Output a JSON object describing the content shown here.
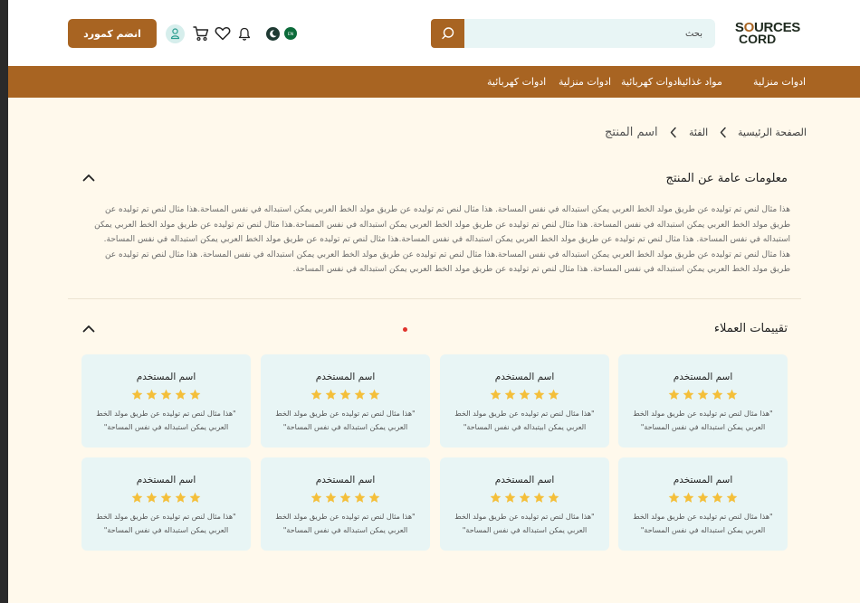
{
  "header": {
    "logo_line1_a": "S",
    "logo_line1_o": "O",
    "logo_line1_b": "URCES",
    "logo_line2": "CORD",
    "search_placeholder": "بحث",
    "join_label": "انضم كمورد",
    "lang_flag_text": "EN"
  },
  "nav": {
    "items": [
      "ادوات منزلية",
      "مواد غذائية",
      "ادوات كهربائية",
      "ادوات منزلية",
      "ادوات كهربائية"
    ]
  },
  "breadcrumb": {
    "home": "الصفحة الرئيسية",
    "category": "الفئة",
    "current": "اسم المنتج"
  },
  "info_section": {
    "title": "معلومات عامة عن المنتج",
    "description": "هذا مثال لنص تم توليده عن طريق مولد الخط العربي يمكن استبداله في نفس المساحة. هذا مثال لنص تم توليده عن طريق مولد الخط العربي يمكن استبداله في نفس المساحة.هذا مثال لنص تم توليده عن طريق مولد الخط العربي يمكن استبداله في نفس المساحة. هذا مثال لنص تم توليده عن طريق مولد الخط العربي يمكن استبداله في نفس المساحة.هذا مثال لنص تم توليده عن طريق مولد الخط العربي يمكن استبداله في نفس المساحة. هذا مثال لنص تم توليده عن طريق مولد الخط العربي يمكن استبداله في نفس المساحة.هذا مثال لنص تم توليده عن طريق مولد الخط العربي يمكن استبداله في نفس المساحة. هذا مثال لنص تم توليده عن طريق مولد الخط العربي يمكن استبداله في نفس المساحة.هذا مثال لنص تم توليده عن طريق مولد الخط العربي يمكن استبداله في نفس المساحة. هذا مثال لنص تم توليده عن طريق مولد الخط العربي يمكن استبداله في نفس المساحة. هذا مثال لنص تم توليده عن طريق مولد الخط العربي يمكن استبداله في نفس المساحة."
  },
  "reviews_section": {
    "title": "تقييمات العملاء",
    "reviews": [
      {
        "user": "اسم المستخدم",
        "rating": 5,
        "text": "\"هذا مثال لنص تم توليده عن طريق مولد الخط العربي يمكن استبداله في نفس المساحة\""
      },
      {
        "user": "اسم المستخدم",
        "rating": 5,
        "text": "\"هذا مثال لنص تم توليده عن طريق مولد الخط العربي يمكن ابيتبداله في نفس المساحة\""
      },
      {
        "user": "اسم المستخدم",
        "rating": 5,
        "text": "\"هذا مثال لنص تم توليده عن طريق مولد الخط العربي يمكن استبداله في نفس المساحة\""
      },
      {
        "user": "اسم المستخدم",
        "rating": 5,
        "text": "\"هذا مثال لنص تم توليده عن طريق مولد الخط العربي يمكن استبداله في نفس المساحة\""
      },
      {
        "user": "اسم المستخدم",
        "rating": 5,
        "text": "\"هذا مثال لنص تم توليده عن طريق مولد الخط العربي يمكن استبداله في نفس المساحة\""
      },
      {
        "user": "اسم المستخدم",
        "rating": 5,
        "text": "\"هذا مثال لنص تم توليده عن طريق مولد الخط العربي يمكن استبداله في نفس المساحة\""
      },
      {
        "user": "اسم المستخدم",
        "rating": 5,
        "text": "\"هذا مثال لنص تم توليده عن طريق مولد الخط العربي يمكن استبداله في نفس المساحة\""
      },
      {
        "user": "اسم المستخدم",
        "rating": 5,
        "text": "\"هذا مثال لنص تم توليده عن طريق مولد الخط العربي يمكن استبداله في نفس المساحة\""
      }
    ]
  },
  "icons": {
    "search": "search-icon",
    "user": "user-icon",
    "cart": "cart-icon",
    "wishlist": "heart-icon",
    "notifications": "bell-icon",
    "theme": "moon-icon",
    "language": "flag-icon",
    "breadcrumb_sep": "chevron-left-icon",
    "collapse": "chevron-up-icon",
    "star": "star-icon"
  },
  "colors": {
    "brand": "#a86422",
    "page_bg": "#fff9ec",
    "card_bg": "#e8f5f5",
    "star": "#f4bf3a",
    "dark": "#1f3a33"
  }
}
